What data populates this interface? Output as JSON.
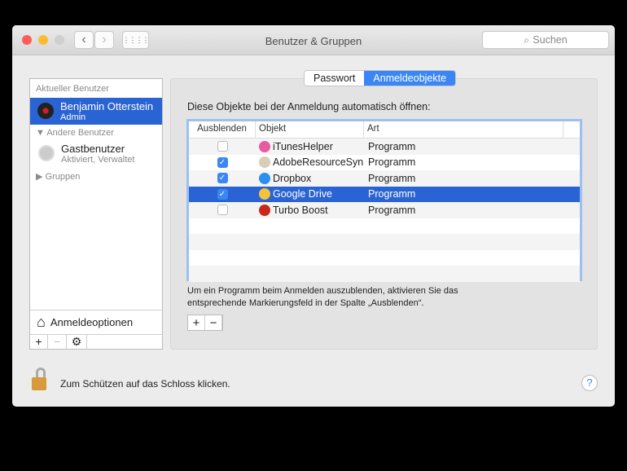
{
  "window": {
    "title": "Benutzer & Gruppen",
    "search_placeholder": "Suchen"
  },
  "sidebar": {
    "current_header": "Aktueller Benutzer",
    "current_user": {
      "name": "Benjamin Otterstein",
      "role": "Admin"
    },
    "others_header": "Andere Benutzer",
    "guest": {
      "name": "Gastbenutzer",
      "status": "Aktiviert, Verwaltet"
    },
    "groups": "Gruppen",
    "login_options": "Anmeldeoptionen"
  },
  "tabs": [
    {
      "label": "Passwort",
      "active": false
    },
    {
      "label": "Anmeldeobjekte",
      "active": true
    }
  ],
  "main": {
    "heading": "Diese Objekte bei der Anmeldung automatisch öffnen:",
    "columns": [
      "Ausblenden",
      "Objekt",
      "Art"
    ],
    "rows": [
      {
        "hide": false,
        "name": "iTunesHelper",
        "kind": "Programm",
        "icon": "itunes-icon",
        "color": "#e85ba0"
      },
      {
        "hide": true,
        "name": "AdobeResourceSyn",
        "kind": "Programm",
        "icon": "adobe-icon",
        "color": "#d9cdb8"
      },
      {
        "hide": true,
        "name": "Dropbox",
        "kind": "Programm",
        "icon": "dropbox-icon",
        "color": "#2a8ff0"
      },
      {
        "hide": true,
        "name": "Google Drive",
        "kind": "Programm",
        "icon": "google-drive-icon",
        "color": "#f5c33b",
        "selected": true
      },
      {
        "hide": false,
        "name": "Turbo Boost",
        "kind": "Programm",
        "icon": "turbo-boost-icon",
        "color": "#c9261c"
      }
    ],
    "hint": "Um ein Programm beim Anmelden auszublenden, aktivieren Sie das entsprechende Markierungsfeld in der Spalte „Ausblenden“."
  },
  "footer": {
    "lock_text": "Zum Schützen auf das Schloss klicken.",
    "help": "?"
  },
  "symbols": {
    "plus": "+",
    "minus": "−",
    "gear": "⚙",
    "check": "✓"
  }
}
